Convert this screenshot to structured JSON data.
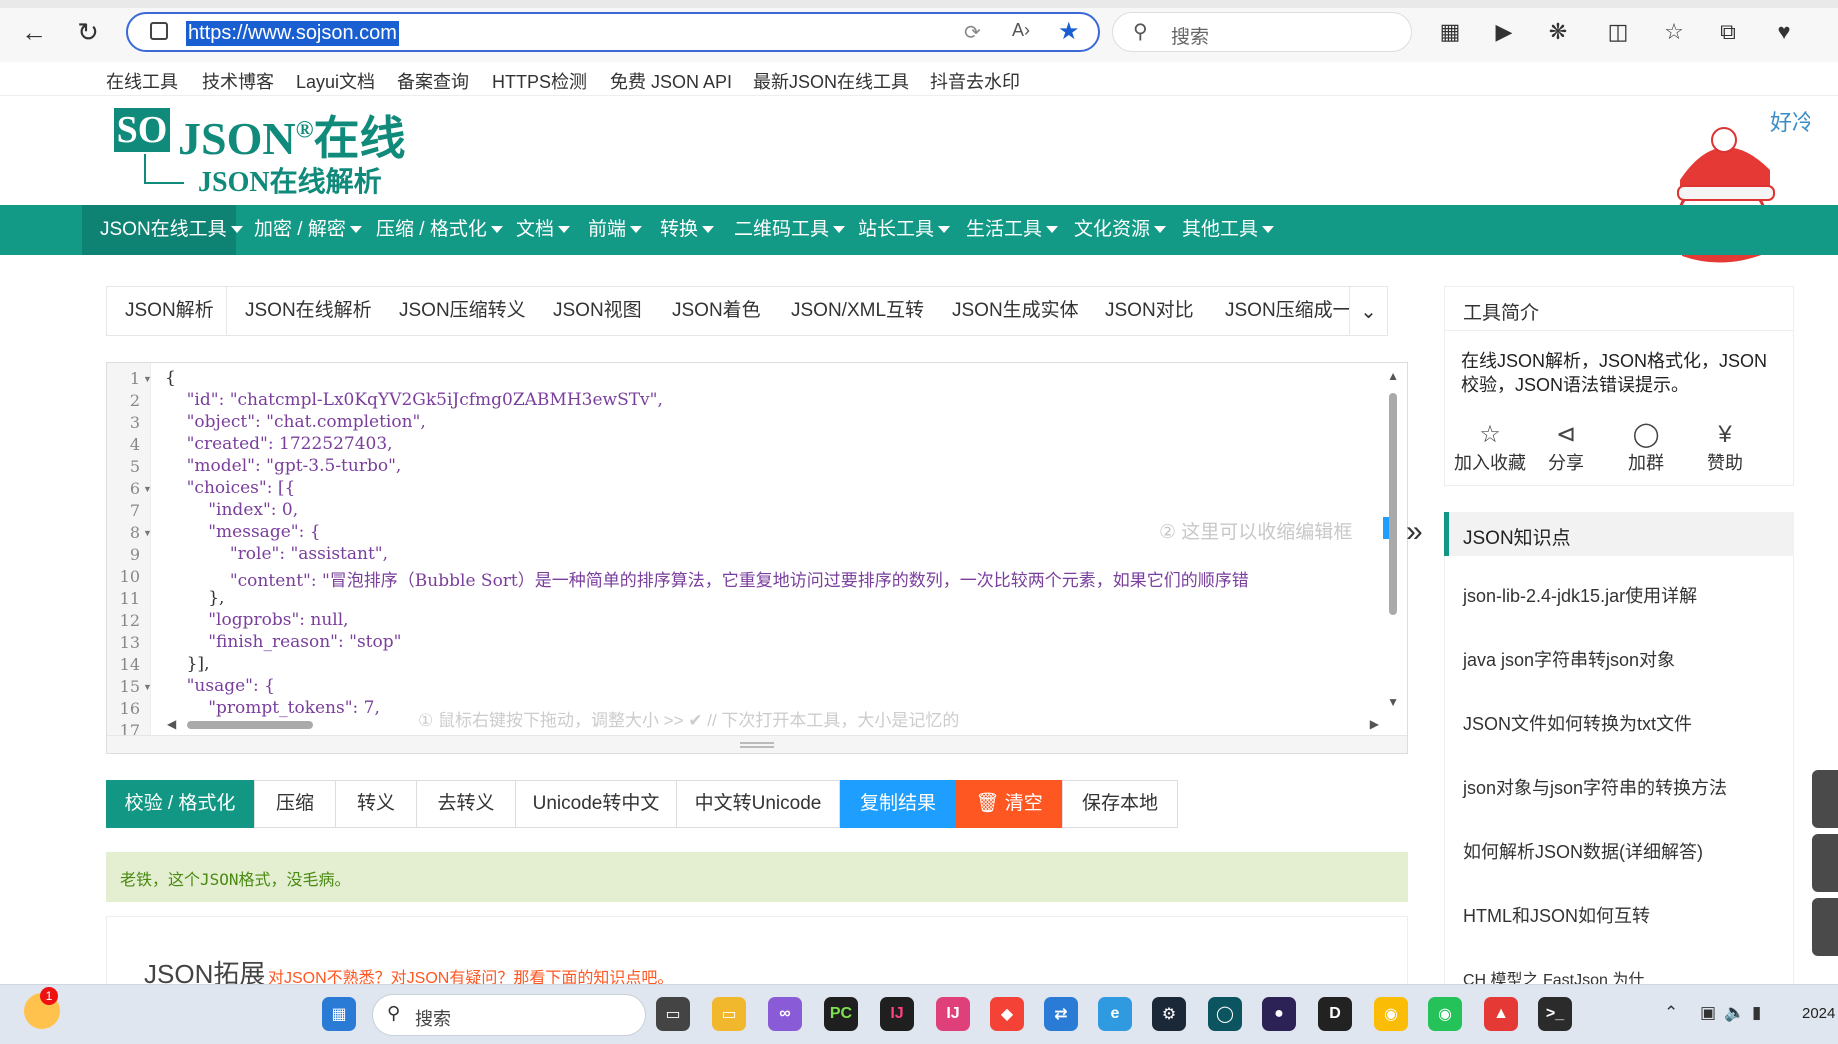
{
  "browser": {
    "url": "https://www.sojson.com",
    "search_placeholder": "搜索"
  },
  "bookmarks": [
    "在线工具",
    "技术博客",
    "Layui文档",
    "备案查询",
    "HTTPS检测",
    "免费 JSON API",
    "最新JSON在线工具",
    "抖音去水印"
  ],
  "logo": {
    "so": "SO",
    "json": "JSON",
    "reg": "®",
    "online": "在线",
    "sub": "JSON在线解析"
  },
  "mascot_text": "好冷",
  "nav": [
    "JSON在线工具",
    "加密 / 解密",
    "压缩 / 格式化",
    "文档",
    "前端",
    "转换",
    "二维码工具",
    "站长工具",
    "生活工具",
    "文化资源",
    "其他工具"
  ],
  "tabs": [
    "JSON解析",
    "JSON在线解析",
    "JSON压缩转义",
    "JSON视图",
    "JSON着色",
    "JSON/XML互转",
    "JSON生成实体",
    "JSON对比",
    "JSON压缩成一行"
  ],
  "editor": {
    "line_numbers": [
      "1",
      "2",
      "3",
      "4",
      "5",
      "6",
      "7",
      "8",
      "9",
      "10",
      "11",
      "12",
      "13",
      "14",
      "15",
      "16",
      "17"
    ],
    "lines": [
      "{",
      "    \"id\": \"chatcmpl-Lx0KqYV2Gk5iJcfmg0ZABMH3ewSTv\",",
      "    \"object\": \"chat.completion\",",
      "    \"created\": 1722527403,",
      "    \"model\": \"gpt-3.5-turbo\",",
      "    \"choices\": [{",
      "        \"index\": 0,",
      "        \"message\": {",
      "            \"role\": \"assistant\",",
      "            \"content\": \"冒泡排序（Bubble Sort）是一种简单的排序算法，它重复地访问过要排序的数列，一次比较两个元素，如果它们的顺序错",
      "        },",
      "        \"logprobs\": null,",
      "        \"finish_reason\": \"stop\"",
      "    }],",
      "    \"usage\": {",
      "        \"prompt_tokens\": 7,",
      ""
    ],
    "collapse_hint": "② 这里可以收缩编辑框",
    "resize_hint": "① 鼠标右键按下拖动，调整大小 >> ✔ // 下次打开本工具，大小是记忆的"
  },
  "actions": [
    "校验 / 格式化",
    "压缩",
    "转义",
    "去转义",
    "Unicode转中文",
    "中文转Unicode",
    "复制结果",
    "清空",
    "保存本地"
  ],
  "result_message": "老铁，这个JSON格式，没毛病。",
  "extension": {
    "title": "JSON拓展",
    "subtitle": "对JSON不熟悉？对JSON有疑问？那看下面的知识点吧。"
  },
  "sidebar": {
    "intro_title": "工具简介",
    "intro_text": "在线JSON解析，JSON格式化，JSON校验，JSON语法错误提示。",
    "share": [
      {
        "icon": "star-icon",
        "label": "加入收藏"
      },
      {
        "icon": "share-icon",
        "label": "分享"
      },
      {
        "icon": "qq-icon",
        "label": "加群"
      },
      {
        "icon": "yen-icon",
        "label": "赞助"
      }
    ],
    "knowledge_title": "JSON知识点",
    "knowledge": [
      "json-lib-2.4-jdk15.jar使用详解",
      "java json字符串转json对象",
      "JSON文件如何转换为txt文件",
      "json对象与json字符串的转换方法",
      "如何解析JSON数据(详细解答)",
      "HTML和JSON如何互转",
      "CH 模型之 FastJson 为什"
    ]
  },
  "taskbar": {
    "search_placeholder": "搜索",
    "notification_count": "1",
    "clock": "2024"
  },
  "colors": {
    "brand": "#129a86",
    "blue": "#1e9fff",
    "red": "#ff5722"
  }
}
